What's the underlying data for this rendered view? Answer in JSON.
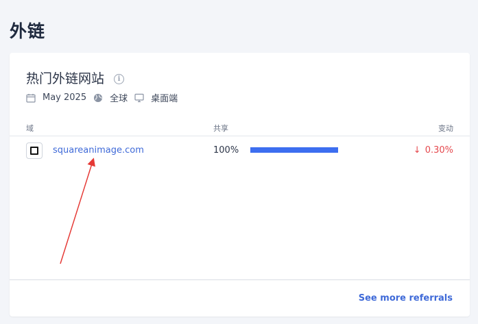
{
  "page": {
    "title": "外链"
  },
  "card": {
    "title": "热门外链网站",
    "info_icon": "info-icon",
    "meta": {
      "date": "May 2025",
      "date_icon": "calendar-icon",
      "region": "全球",
      "region_icon": "globe-icon",
      "device": "桌面端",
      "device_icon": "desktop-icon"
    },
    "table": {
      "columns": {
        "domain": "域",
        "share": "共享",
        "change": "变动"
      },
      "rows": [
        {
          "favicon_icon": "site-favicon-icon",
          "domain": "squareanimage.com",
          "share": "100%",
          "share_fraction": 1.0,
          "change_direction": "down",
          "change_arrow": "↓",
          "change": "0.30%"
        }
      ]
    },
    "footer": {
      "see_more_label": "See more referrals"
    }
  },
  "colors": {
    "link": "#3f6ad8",
    "bar": "#3d6ef0",
    "negative": "#e5484d",
    "annotation_arrow": "#e53935"
  }
}
